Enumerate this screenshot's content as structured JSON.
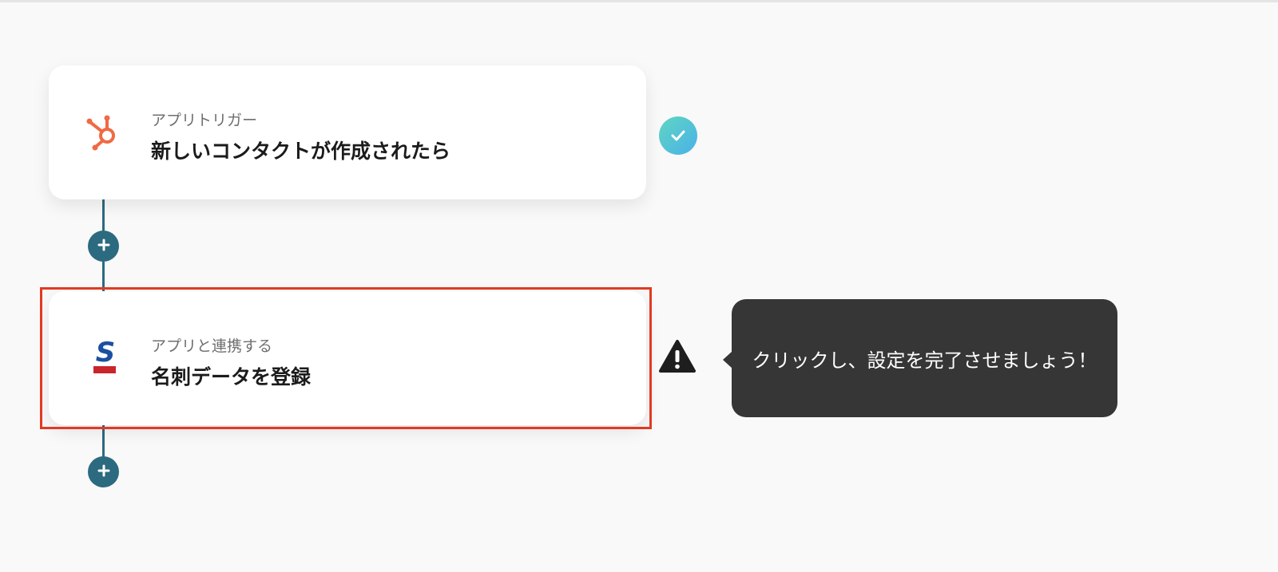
{
  "steps": [
    {
      "subtitle": "アプリトリガー",
      "title": "新しいコンタクトが作成されたら",
      "app_icon": "hubspot-icon",
      "status": "completed"
    },
    {
      "subtitle": "アプリと連携する",
      "title": "名刺データを登録",
      "app_icon": "sansan-icon",
      "status": "warning"
    }
  ],
  "tooltip": {
    "text": "クリックし、設定を完了させましょう！"
  },
  "colors": {
    "background": "#f9f9f9",
    "connector": "#2c6a80",
    "highlight": "#e23a22",
    "hubspot": "#f06a43",
    "sansan_blue": "#1c4fa0",
    "sansan_red": "#c9252c",
    "check_start": "#5fd6c2",
    "check_end": "#4ab1e8",
    "tooltip_bg": "#363636"
  }
}
